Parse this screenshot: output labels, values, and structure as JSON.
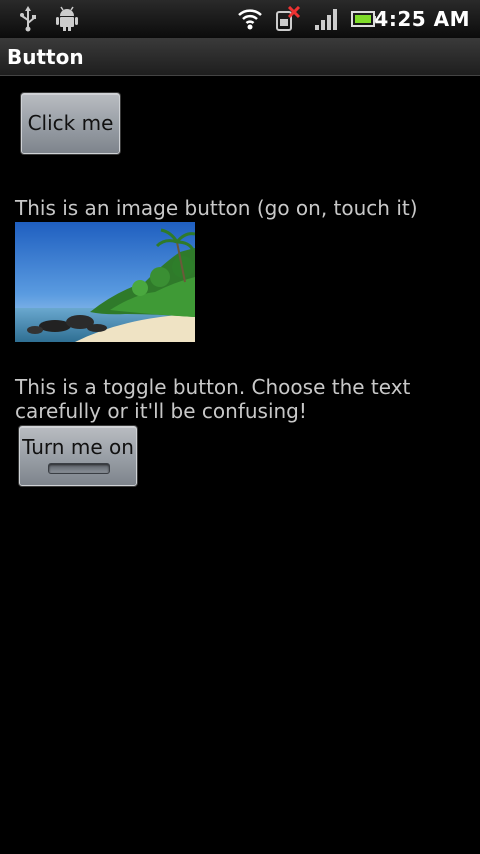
{
  "status_bar": {
    "time": "4:25 AM",
    "icons": [
      "usb-icon",
      "android-debug-icon",
      "wifi-icon",
      "no-sim-icon",
      "signal-icon",
      "battery-icon"
    ]
  },
  "title_bar": {
    "title": "Button"
  },
  "main": {
    "click_button_label": "Click me",
    "image_button_caption": "This is an image button (go on, touch it)",
    "image_button_picture": "tropical-beach-icon",
    "toggle_caption": "This is a toggle button. Choose the text carefully or it'll be confusing!",
    "toggle_label": "Turn me on",
    "toggle_state": "off"
  },
  "colors": {
    "background": "#000000",
    "text": "#c8c8c8",
    "button_top": "#b9bcc1",
    "button_bottom": "#7e848c"
  }
}
